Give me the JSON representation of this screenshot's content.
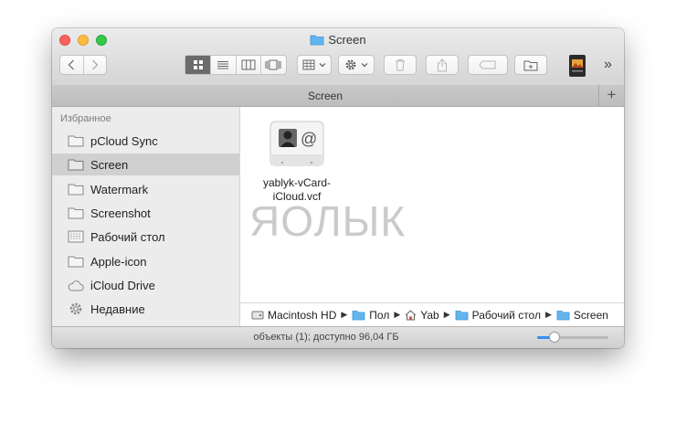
{
  "window": {
    "title": "Screen"
  },
  "toolbar": {
    "more_label": "»",
    "view_mode_active": "icons"
  },
  "tabbar": {
    "tab_label": "Screen",
    "add_label": "+"
  },
  "sidebar": {
    "header": "Избранное",
    "items": [
      {
        "label": "pCloud Sync",
        "icon": "folder-icon"
      },
      {
        "label": "Screen",
        "icon": "folder-icon",
        "selected": true
      },
      {
        "label": "Watermark",
        "icon": "folder-icon"
      },
      {
        "label": "Screenshot",
        "icon": "folder-icon"
      },
      {
        "label": "Рабочий стол",
        "icon": "desktop-icon"
      },
      {
        "label": "Apple-icon",
        "icon": "folder-icon"
      },
      {
        "label": "iCloud Drive",
        "icon": "cloud-icon"
      },
      {
        "label": "Недавние",
        "icon": "gear-icon"
      }
    ]
  },
  "content": {
    "files": [
      {
        "name": "yablyk-vCard-iCloud.vcf",
        "icon": "vcard-icon"
      }
    ],
    "watermark": "ЯОЛЫК"
  },
  "pathbar": {
    "items": [
      {
        "label": "Macintosh HD",
        "icon": "hd-icon"
      },
      {
        "label": "Пол",
        "icon": "folder-icon"
      },
      {
        "label": "Yab",
        "icon": "home-icon"
      },
      {
        "label": "Рабочий стол",
        "icon": "folder-icon"
      },
      {
        "label": "Screen",
        "icon": "folder-icon"
      }
    ]
  },
  "statusbar": {
    "text": "объекты (1); доступно 96,04 ГБ",
    "zoom_fraction": 0.24
  },
  "colors": {
    "accent": "#3b8ff0",
    "folder": "#63b5ef"
  }
}
